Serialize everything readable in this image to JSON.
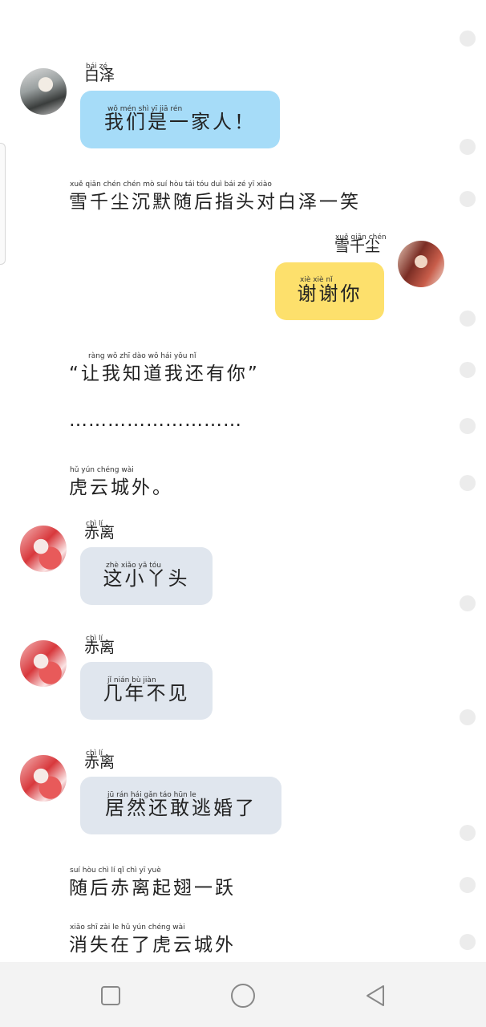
{
  "characters": {
    "bai_ze": "白泽",
    "xue_qianchen": "雪千尘",
    "chi_li": "赤离"
  },
  "messages": [
    {
      "type": "chat",
      "speaker": "白泽",
      "text": "我们是一家人！"
    },
    {
      "type": "narration",
      "text": "雪千尘沉默随后指头对白泽一笑"
    },
    {
      "type": "chat",
      "speaker": "雪千尘",
      "text": "谢谢你"
    },
    {
      "type": "narration",
      "text": "“让我知道我还有你”"
    },
    {
      "type": "narration",
      "text": "………………………"
    },
    {
      "type": "narration",
      "text": "虎云城外。"
    },
    {
      "type": "chat",
      "speaker": "赤离",
      "text": "这小丫头"
    },
    {
      "type": "chat",
      "speaker": "赤离",
      "text": "几年不见"
    },
    {
      "type": "chat",
      "speaker": "赤离",
      "text": "居然还敢逃婚了"
    },
    {
      "type": "narration",
      "text": "随后赤离起翅一跃"
    },
    {
      "type": "narration",
      "text": "消失在了虎云城外"
    }
  ],
  "pinyin": {
    "m0_name": "bái zé",
    "m0": "wǒ mén shì yī jiā rén",
    "m1": "xuě qiān chén chén mò suí hòu tái tóu duì bái zé yī xiào",
    "m2_name": "xuě qiān chén",
    "m2": "xiè xiè nǐ",
    "m3": "ràng wǒ zhī dào wǒ hái yǒu nǐ",
    "m5": "hǔ yún chéng wài",
    "m6_name": "chì lí",
    "m6": "zhè xiǎo yā tóu",
    "m7_name": "chì lí",
    "m7": "jǐ nián bù jiàn",
    "m8_name": "chì lí",
    "m8": "jū rán hái gǎn táo hūn le",
    "m9": "suí hòu chì lí qǐ chì yī yuè",
    "m10": "xiāo shī zài le hǔ yún chéng wài"
  },
  "avatars": {
    "bai_ze": "white-haired-man-portrait",
    "chi_li": "red-haired-girl-portrait",
    "xue_qianchen": "dark-haired-woman-portrait"
  },
  "colors": {
    "bubble_bai_ze": "#a6dcf8",
    "bubble_xue_qianchen": "#fde06c",
    "bubble_chi_li": "#e0e6ee",
    "nav_bar": "#f3f3f3"
  },
  "nav": {
    "recents_icon": "square-icon",
    "home_icon": "circle-icon",
    "back_icon": "triangle-back-icon"
  }
}
